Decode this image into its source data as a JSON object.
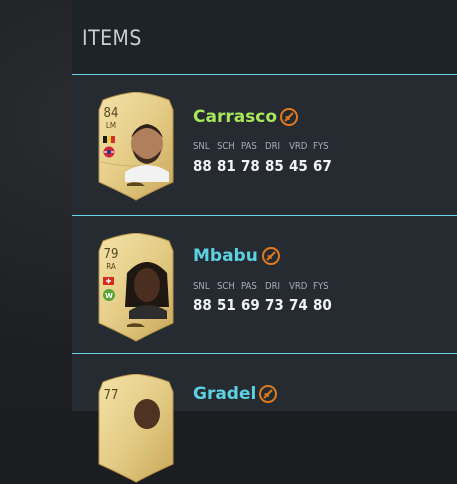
{
  "panel": {
    "title": "ITEMS"
  },
  "stat_headers": [
    "SNL",
    "SCH",
    "PAS",
    "DRI",
    "VRD",
    "FYS"
  ],
  "items": [
    {
      "name": "Carrasco",
      "name_color": "#a8e65a",
      "rating": "84",
      "position": "LM",
      "stats": [
        "88",
        "81",
        "78",
        "85",
        "45",
        "67"
      ]
    },
    {
      "name": "Mbabu",
      "name_color": "#5fd0e0",
      "rating": "79",
      "position": "RA",
      "stats": [
        "88",
        "51",
        "69",
        "73",
        "74",
        "80"
      ]
    },
    {
      "name": "Gradel",
      "name_color": "#5fd0e0",
      "rating": "77",
      "position": "",
      "stats": []
    }
  ],
  "colors": {
    "accent_line": "#6ad4e6",
    "untradeable": "#e07a1f",
    "card_gold": "#e4cc86"
  },
  "icons": {
    "untradeable": "untradeable-icon"
  }
}
